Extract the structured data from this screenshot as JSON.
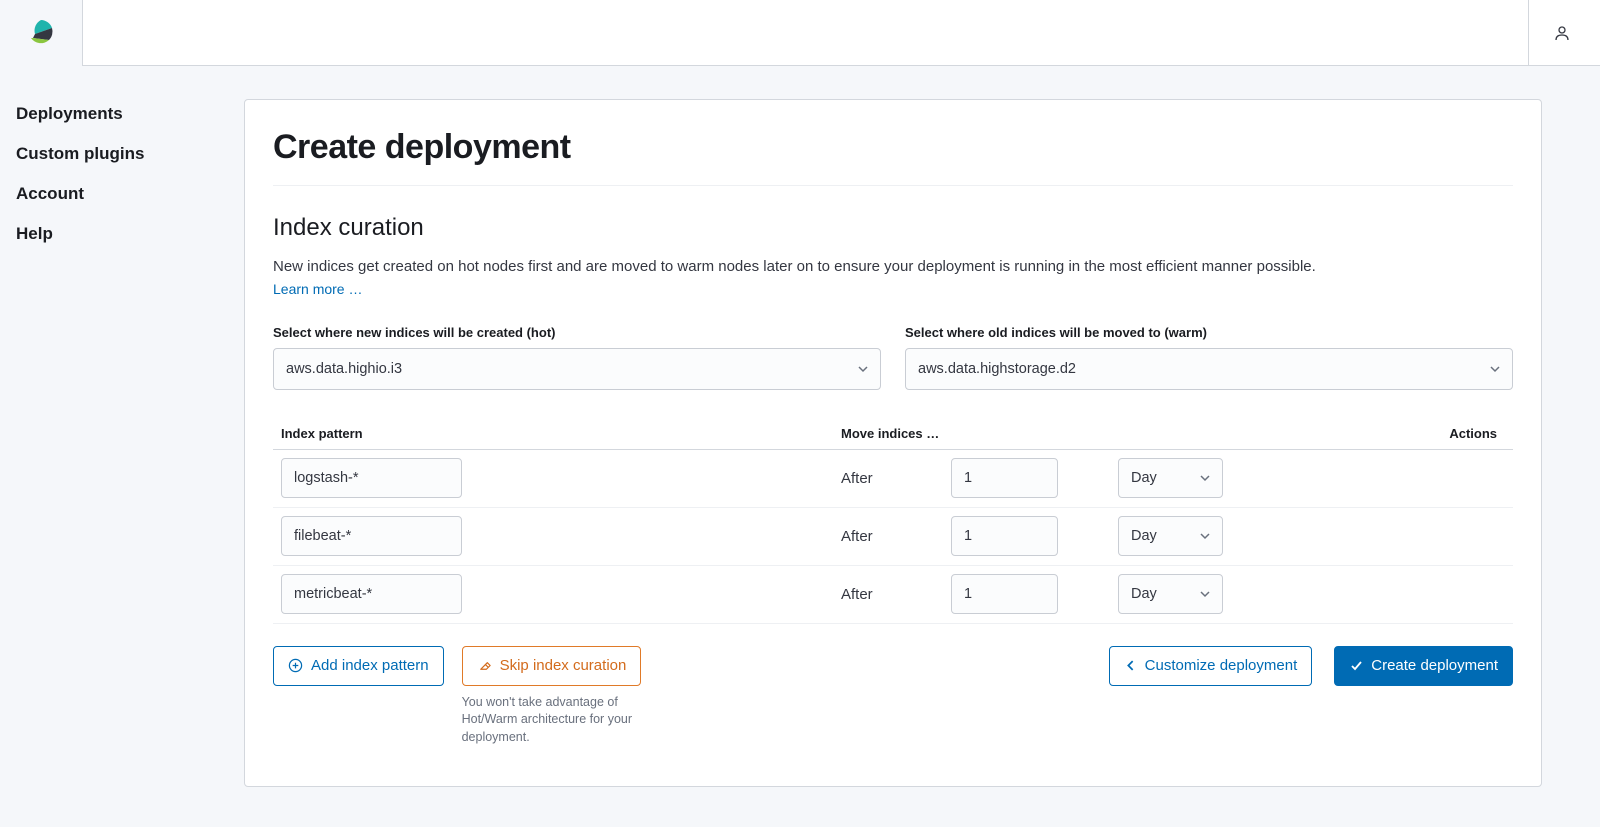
{
  "sidebar": {
    "items": [
      {
        "label": "Deployments"
      },
      {
        "label": "Custom plugins"
      },
      {
        "label": "Account"
      },
      {
        "label": "Help"
      }
    ]
  },
  "page": {
    "title": "Create deployment"
  },
  "section": {
    "title": "Index curation",
    "description": "New indices get created on hot nodes first and are moved to warm nodes later on to ensure your deployment is running in the most efficient manner possible.",
    "learn_more": "Learn more …"
  },
  "selects": {
    "hot_label": "Select where new indices will be created (hot)",
    "hot_value": "aws.data.highio.i3",
    "warm_label": "Select where old indices will be moved to (warm)",
    "warm_value": "aws.data.highstorage.d2"
  },
  "table": {
    "headers": {
      "pattern": "Index pattern",
      "move": "Move indices …",
      "actions": "Actions"
    },
    "after_label": "After",
    "unit_label": "Day",
    "rows": [
      {
        "pattern": "logstash-*",
        "value": "1"
      },
      {
        "pattern": "filebeat-*",
        "value": "1"
      },
      {
        "pattern": "metricbeat-*",
        "value": "1"
      }
    ]
  },
  "buttons": {
    "add_pattern": "Add index pattern",
    "skip_curation": "Skip index curation",
    "skip_help": "You won't take advantage of Hot/Warm architecture for your deployment.",
    "customize": "Customize deployment",
    "create": "Create deployment"
  }
}
